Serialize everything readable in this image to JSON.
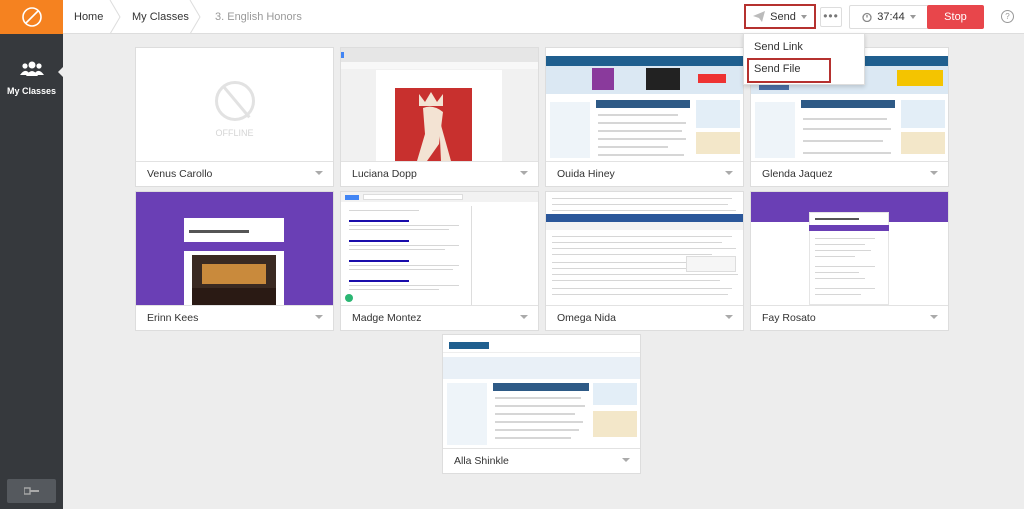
{
  "sidebar": {
    "logo_icon": "compass-logo-icon",
    "nav": [
      {
        "label": "My Classes",
        "icon": "users-icon"
      }
    ],
    "bottom_icon": "key-icon"
  },
  "breadcrumb": [
    "Home",
    "My Classes",
    "3. English Honors"
  ],
  "toolbar": {
    "send_label": "Send",
    "more_label": "•••",
    "timer": "37:44",
    "stop_label": "Stop",
    "help_label": "?"
  },
  "send_menu": [
    "Send Link",
    "Send File"
  ],
  "offline_label": "OFFLINE",
  "students": [
    {
      "name": "Venus Carollo",
      "status": "offline"
    },
    {
      "name": "Luciana Dopp",
      "status": "online"
    },
    {
      "name": "Ouida Hiney",
      "status": "online"
    },
    {
      "name": "Glenda Jaquez",
      "status": "online"
    },
    {
      "name": "Erinn Kees",
      "status": "online"
    },
    {
      "name": "Madge Montez",
      "status": "online"
    },
    {
      "name": "Omega Nida",
      "status": "online"
    },
    {
      "name": "Fay Rosato",
      "status": "online"
    },
    {
      "name": "Alla Shinkle",
      "status": "online"
    }
  ],
  "colors": {
    "accent": "#f58220",
    "stop": "#e8464b",
    "highlight": "#b5312f",
    "sidebar": "#36393d"
  }
}
